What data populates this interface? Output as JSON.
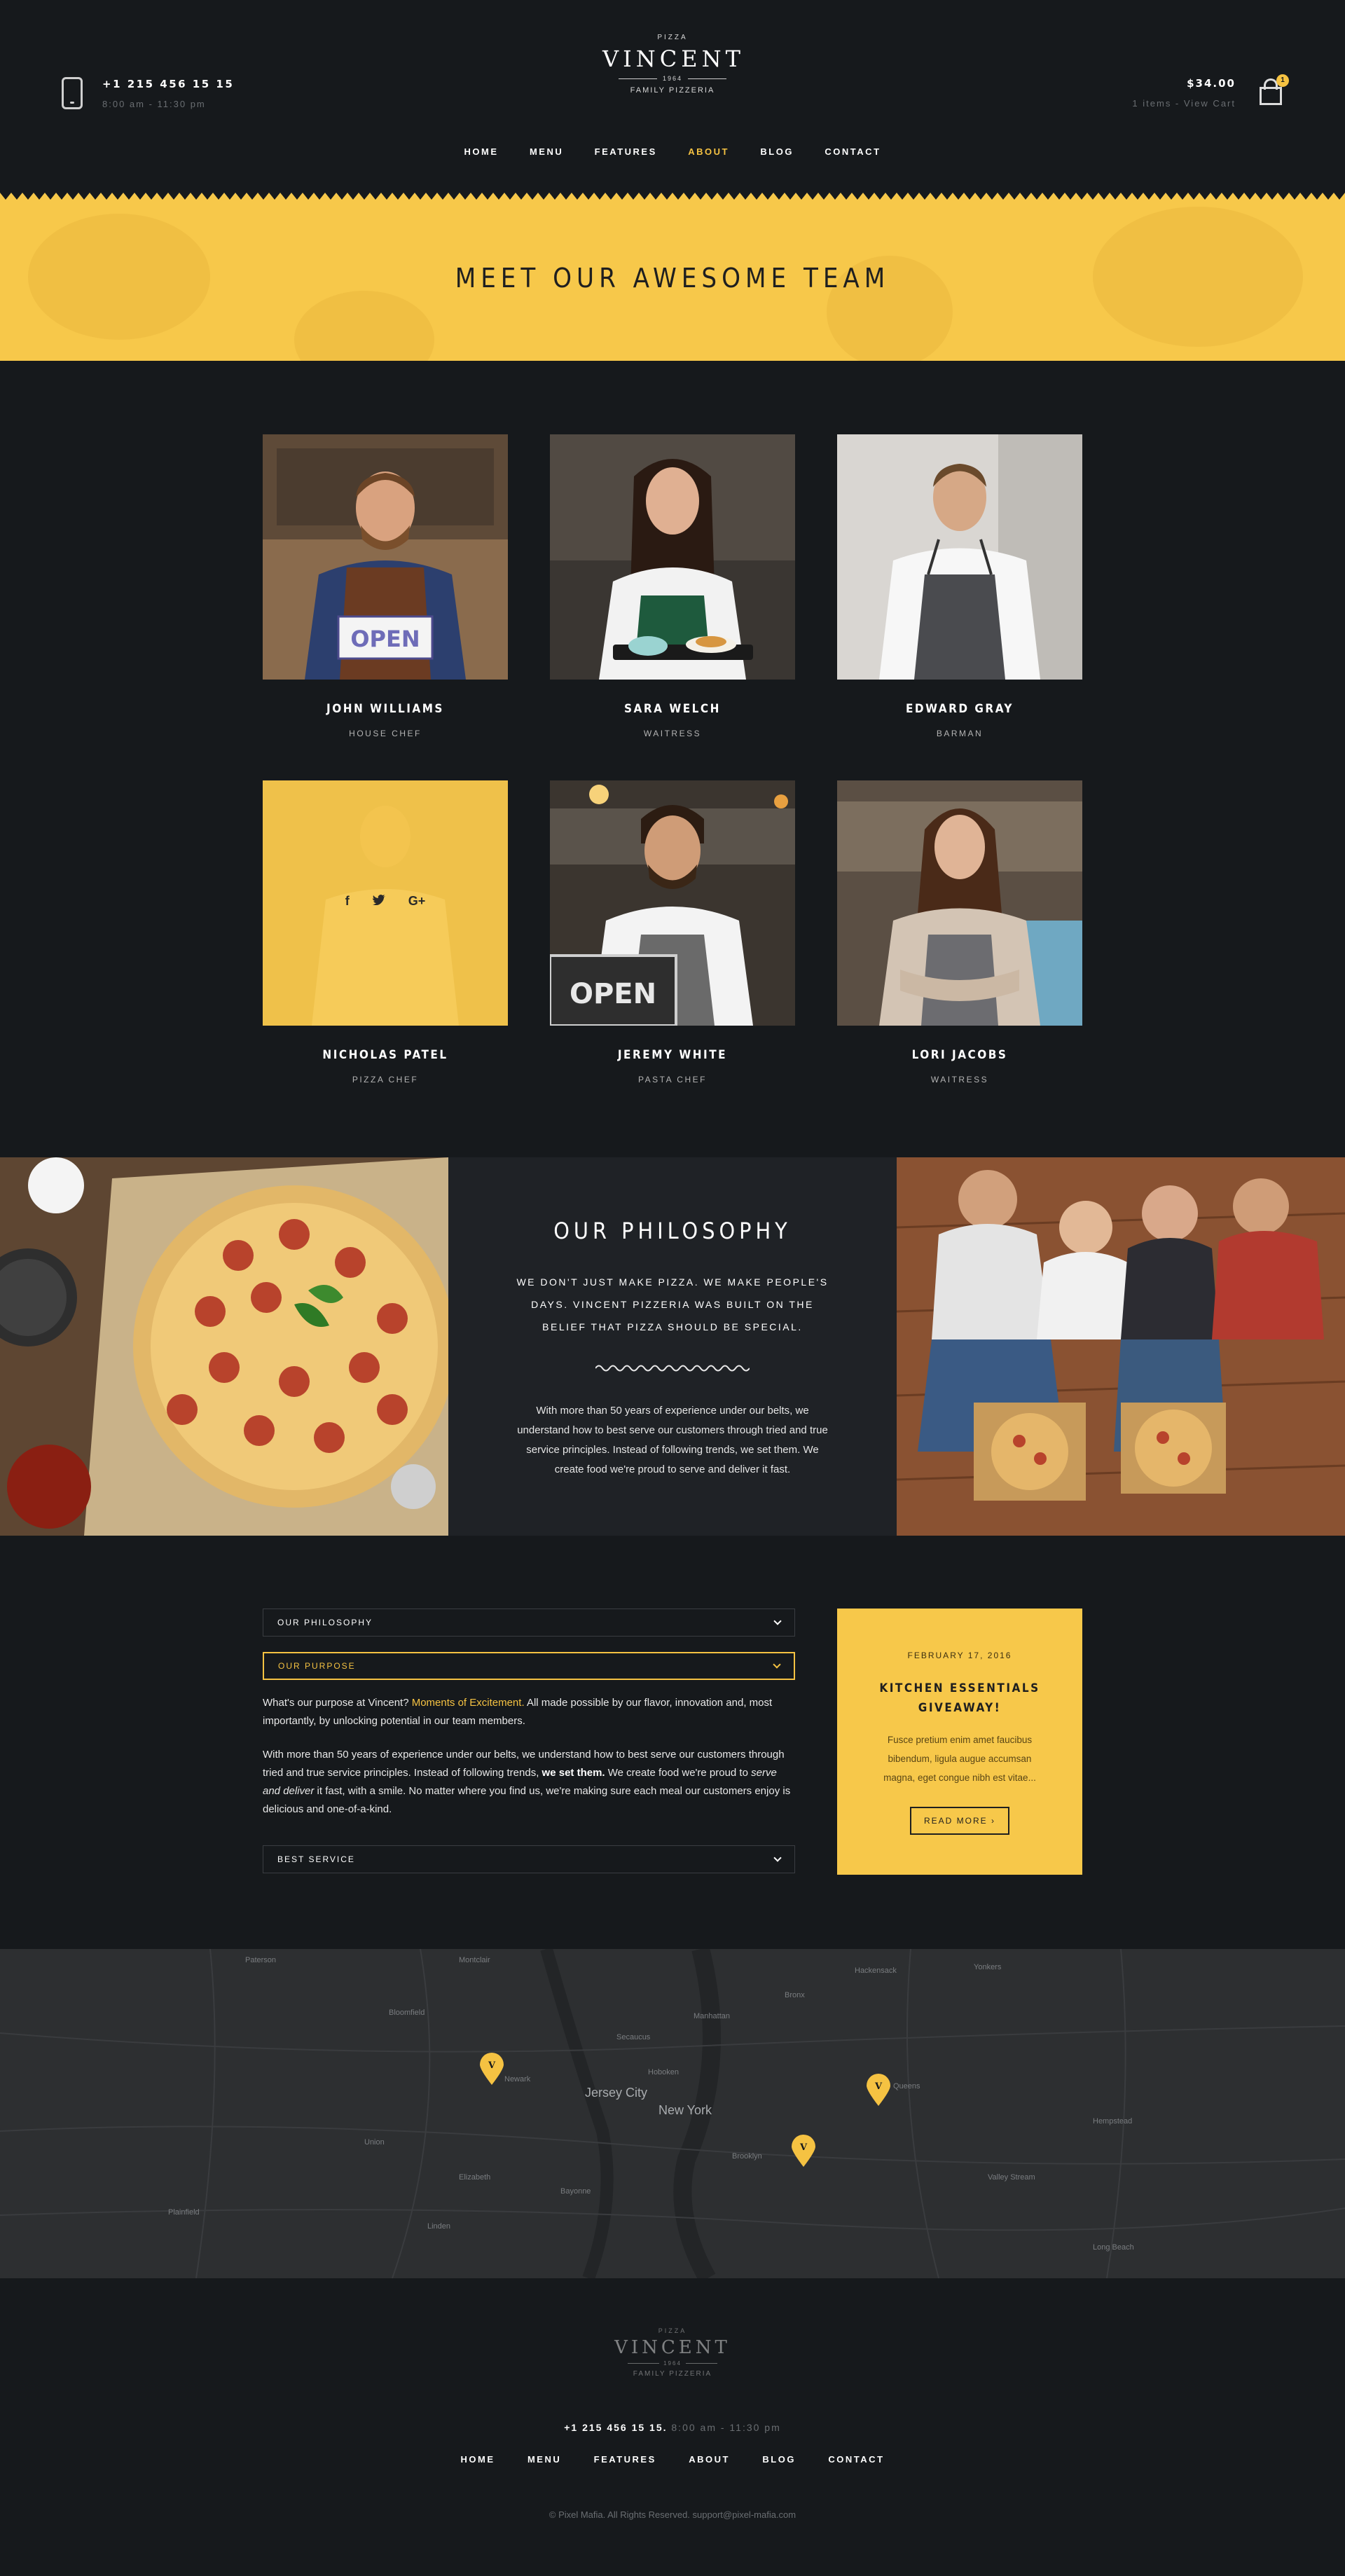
{
  "header": {
    "phone": "+1 215 456 15 15",
    "hours": "8:00 am - 11:30 pm",
    "logo": {
      "top": "PIZZA",
      "brand": "VINCENT",
      "year": "1964",
      "tagline": "FAMILY PIZZERIA"
    },
    "cart": {
      "total": "$34.00",
      "items": "1 items - View Cart",
      "count": "1"
    },
    "nav": [
      {
        "label": "HOME"
      },
      {
        "label": "MENU"
      },
      {
        "label": "FEATURES"
      },
      {
        "label": "ABOUT",
        "active": true
      },
      {
        "label": "BLOG"
      },
      {
        "label": "CONTACT"
      }
    ]
  },
  "hero": {
    "title": "MEET OUR AWESOME TEAM"
  },
  "team": [
    {
      "name": "JOHN WILLIAMS",
      "role": "HOUSE CHEF"
    },
    {
      "name": "SARA WELCH",
      "role": "WAITRESS"
    },
    {
      "name": "EDWARD GRAY",
      "role": "BARMAN"
    },
    {
      "name": "NICHOLAS PATEL",
      "role": "PIZZA CHEF"
    },
    {
      "name": "JEREMY WHITE",
      "role": "PASTA CHEF"
    },
    {
      "name": "LORI JACOBS",
      "role": "WAITRESS"
    }
  ],
  "open_sign": "OPEN",
  "socials": [
    "f",
    "t",
    "G+"
  ],
  "philosophy": {
    "title": "OUR PHILOSOPHY",
    "lead": "WE DON'T JUST MAKE PIZZA. WE MAKE PEOPLE'S DAYS. VINCENT PIZZERIA WAS BUILT ON THE BELIEF THAT PIZZA SHOULD BE SPECIAL.",
    "body": "With more than 50 years of experience under our belts, we understand how to best serve our customers through tried and true service principles. Instead of following trends, we set them. We create food we're proud to serve and deliver it fast."
  },
  "accordion": {
    "items": [
      "OUR PHILOSOPHY",
      "OUR PURPOSE",
      "BEST SERVICE"
    ],
    "p1_a": "What's our purpose at Vincent? ",
    "p1_hl": "Moments of Excitement.",
    "p1_b": " All made possible by our flavor, innovation and, most importantly, by unlocking potential in our team members.",
    "p2_a": "With more than 50 years of experience under our belts, we understand how to best serve our customers through tried and true service principles. Instead of following trends, ",
    "p2_b": "we set them.",
    "p2_c": " We create food we're proud to ",
    "p2_i": "serve and deliver",
    "p2_d": " it fast, with a smile. No matter where you find us, we're making sure each meal our customers enjoy is delicious and one-of-a-kind."
  },
  "post": {
    "date": "FEBRUARY 17, 2016",
    "title": "KITCHEN ESSENTIALS GIVEAWAY!",
    "excerpt": "Fusce pretium enim amet faucibus bibendum, ligula augue accumsan magna, eget congue nibh est vitae...",
    "button": "READ MORE"
  },
  "map": {
    "labels": [
      "Montclair",
      "Paterson",
      "Hackensack",
      "Newark",
      "Jersey City",
      "New York",
      "Elizabeth",
      "Bayonne",
      "Brooklyn",
      "Queens",
      "Hempstead",
      "Valley Stream",
      "Yonkers",
      "Plainfield",
      "Union",
      "Linden",
      "Bloomfield",
      "Secaucus",
      "Long Beach",
      "Hoboken",
      "Manhattan",
      "Bronx"
    ],
    "pin_letter": "V"
  },
  "footer": {
    "phone": "+1 215 456 15 15.",
    "hours": "8:00 am - 11:30 pm",
    "nav": [
      "HOME",
      "MENU",
      "FEATURES",
      "ABOUT",
      "BLOG",
      "CONTACT"
    ],
    "copyright": "© Pixel Mafia. All Rights Reserved. support@pixel-mafia.com"
  }
}
